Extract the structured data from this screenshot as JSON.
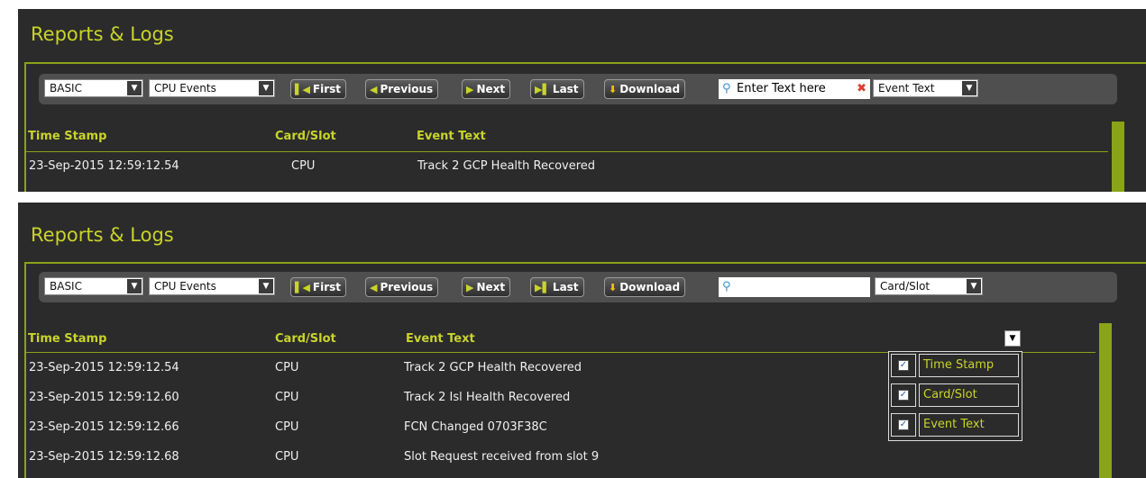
{
  "title": "Reports & Logs",
  "toolbar": {
    "mode": "BASIC",
    "log_type": "CPU Events",
    "first": "First",
    "previous": "Previous",
    "next": "Next",
    "last": "Last",
    "download": "Download"
  },
  "view1": {
    "search_text": "Enter Text here",
    "filter_field": "Event Text"
  },
  "view2": {
    "search_text": "",
    "filter_field": "Card/Slot"
  },
  "columns": [
    "Time Stamp",
    "Card/Slot",
    "Event Text"
  ],
  "rows": [
    [
      "23-Sep-2015 12:59:12.54",
      "CPU",
      "Track 2 GCP Health Recovered"
    ],
    [
      "23-Sep-2015 12:59:12.60",
      "CPU",
      "Track 2 Isl Health Recovered"
    ],
    [
      "23-Sep-2015 12:59:12.66",
      "CPU",
      "FCN Changed 0703F38C"
    ],
    [
      "23-Sep-2015 12:59:12.68",
      "CPU",
      "Slot Request received from slot 9"
    ]
  ],
  "column_menu": {
    "items": [
      {
        "label": "Time Stamp",
        "checked": true
      },
      {
        "label": "Card/Slot",
        "checked": true
      },
      {
        "label": "Event Text",
        "checked": true
      }
    ]
  },
  "colors": {
    "accent": "#c9d42b",
    "frame": "#8aa318",
    "background": "#2b2b2b"
  },
  "icons": [
    "first-icon",
    "previous-icon",
    "next-icon",
    "last-icon",
    "download-icon",
    "search-icon",
    "clear-icon",
    "dropdown-arrow-icon",
    "checkbox-icon"
  ]
}
